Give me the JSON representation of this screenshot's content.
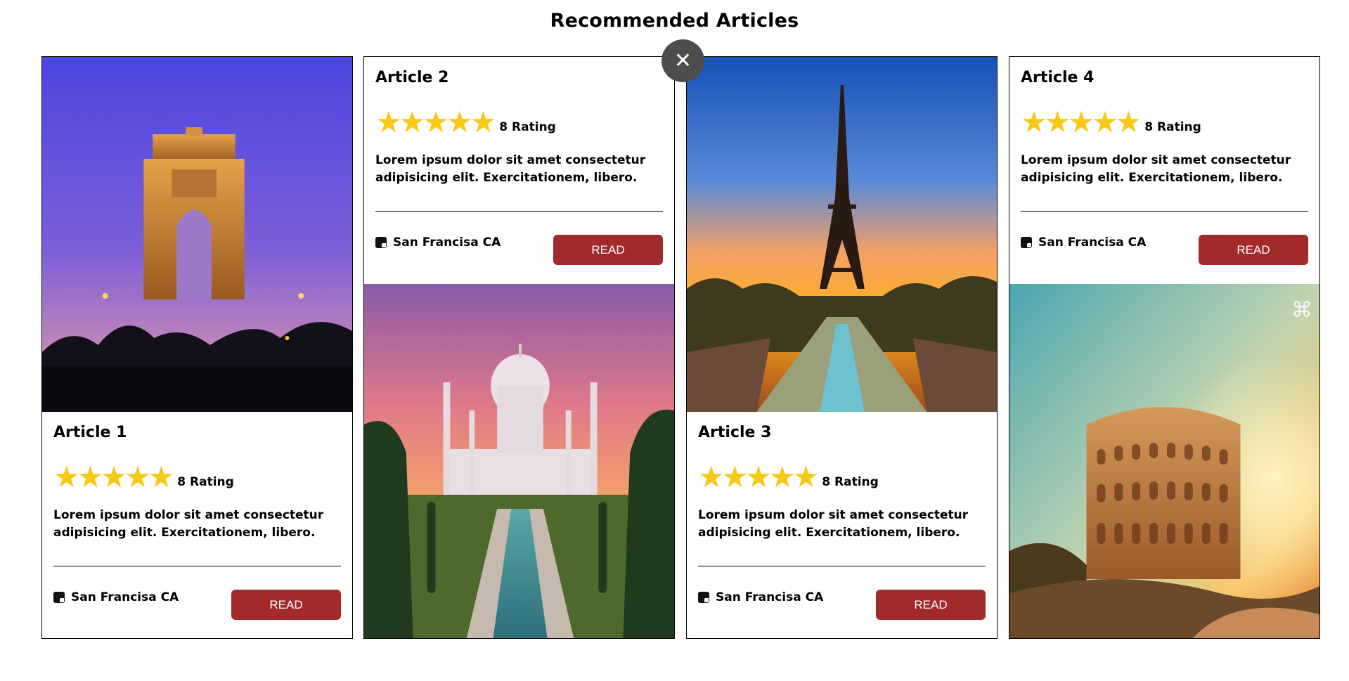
{
  "page": {
    "title": "Recommended Articles",
    "close_label": "✕"
  },
  "colors": {
    "star": "#f7c915",
    "read_button_bg": "#a32a2a",
    "close_button_bg": "#4d4d4d"
  },
  "articles": [
    {
      "title": "Article 1",
      "stars": "★★★★★",
      "rating_text": "8 Rating",
      "description": "Lorem ipsum dolor sit amet consectetur adipisicing elit. Exercitationem, libero.",
      "location": "San Francisa CA",
      "read_label": "READ",
      "image_subject": "India Gate at dusk"
    },
    {
      "title": "Article 2",
      "stars": "★★★★★",
      "rating_text": "8 Rating",
      "description": "Lorem ipsum dolor sit amet consectetur adipisicing elit. Exercitationem, libero.",
      "location": "San Francisa CA",
      "read_label": "READ",
      "image_subject": "Taj Mahal at sunset"
    },
    {
      "title": "Article 3",
      "stars": "★★★★★",
      "rating_text": "8 Rating",
      "description": "Lorem ipsum dolor sit amet consectetur adipisicing elit. Exercitationem, libero.",
      "location": "San Francisa CA",
      "read_label": "READ",
      "image_subject": "Eiffel Tower at sunset"
    },
    {
      "title": "Article 4",
      "stars": "★★★★★",
      "rating_text": "8 Rating",
      "description": "Lorem ipsum dolor sit amet consectetur adipisicing elit. Exercitationem, libero.",
      "location": "San Francisa CA",
      "read_label": "READ",
      "image_subject": "Colosseum at sunset"
    }
  ]
}
